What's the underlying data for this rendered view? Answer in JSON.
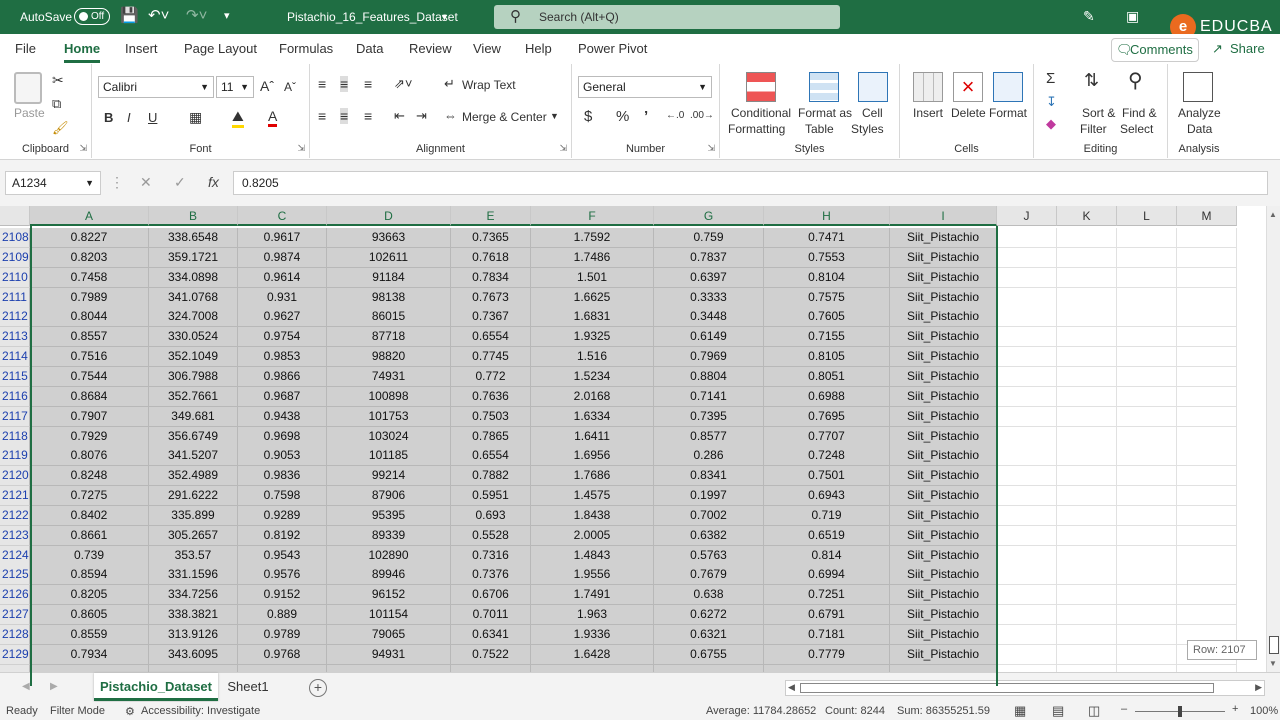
{
  "titlebar": {
    "autosave_label": "AutoSave",
    "autosave_state": "Off",
    "filename": "Pistachio_16_Features_Dataset",
    "search_placeholder": "Search (Alt+Q)",
    "logo_text": "EDUCBA"
  },
  "tabs": [
    "File",
    "Home",
    "Insert",
    "Page Layout",
    "Formulas",
    "Data",
    "Review",
    "View",
    "Help",
    "Power Pivot"
  ],
  "active_tab": "Home",
  "comments_label": "Comments",
  "share_label": "Share",
  "ribbon": {
    "clipboard": {
      "label": "Clipboard",
      "paste": "Paste"
    },
    "font": {
      "label": "Font",
      "name": "Calibri",
      "size": "11"
    },
    "alignment": {
      "label": "Alignment",
      "wrap": "Wrap Text",
      "merge": "Merge & Center"
    },
    "number": {
      "label": "Number",
      "format": "General"
    },
    "styles": {
      "label": "Styles",
      "cond1": "Conditional",
      "cond2": "Formatting",
      "fmt1": "Format as",
      "fmt2": "Table",
      "cell1": "Cell",
      "cell2": "Styles"
    },
    "cells": {
      "label": "Cells",
      "insert": "Insert",
      "delete": "Delete",
      "format": "Format"
    },
    "editing": {
      "label": "Editing",
      "sort1": "Sort &",
      "sort2": "Filter",
      "find1": "Find &",
      "find2": "Select"
    },
    "analysis": {
      "label": "Analysis",
      "analyze1": "Analyze",
      "analyze2": "Data"
    }
  },
  "namebox": "A1234",
  "formula_value": "0.8205",
  "columns": [
    "A",
    "B",
    "C",
    "D",
    "E",
    "F",
    "G",
    "H",
    "I",
    "J",
    "K",
    "L",
    "M"
  ],
  "rows": [
    {
      "n": "2108",
      "v": [
        "0.8227",
        "338.6548",
        "0.9617",
        "93663",
        "0.7365",
        "1.7592",
        "0.759",
        "0.7471",
        "Siit_Pistachio"
      ]
    },
    {
      "n": "2109",
      "v": [
        "0.8203",
        "359.1721",
        "0.9874",
        "102611",
        "0.7618",
        "1.7486",
        "0.7837",
        "0.7553",
        "Siit_Pistachio"
      ]
    },
    {
      "n": "2110",
      "v": [
        "0.7458",
        "334.0898",
        "0.9614",
        "91184",
        "0.7834",
        "1.501",
        "0.6397",
        "0.8104",
        "Siit_Pistachio"
      ]
    },
    {
      "n": "2111",
      "v": [
        "0.7989",
        "341.0768",
        "0.931",
        "98138",
        "0.7673",
        "1.6625",
        "0.3333",
        "0.7575",
        "Siit_Pistachio"
      ]
    },
    {
      "n": "2112",
      "v": [
        "0.8044",
        "324.7008",
        "0.9627",
        "86015",
        "0.7367",
        "1.6831",
        "0.3448",
        "0.7605",
        "Siit_Pistachio"
      ]
    },
    {
      "n": "2113",
      "v": [
        "0.8557",
        "330.0524",
        "0.9754",
        "87718",
        "0.6554",
        "1.9325",
        "0.6149",
        "0.7155",
        "Siit_Pistachio"
      ]
    },
    {
      "n": "2114",
      "v": [
        "0.7516",
        "352.1049",
        "0.9853",
        "98820",
        "0.7745",
        "1.516",
        "0.7969",
        "0.8105",
        "Siit_Pistachio"
      ]
    },
    {
      "n": "2115",
      "v": [
        "0.7544",
        "306.7988",
        "0.9866",
        "74931",
        "0.772",
        "1.5234",
        "0.8804",
        "0.8051",
        "Siit_Pistachio"
      ]
    },
    {
      "n": "2116",
      "v": [
        "0.8684",
        "352.7661",
        "0.9687",
        "100898",
        "0.7636",
        "2.0168",
        "0.7141",
        "0.6988",
        "Siit_Pistachio"
      ]
    },
    {
      "n": "2117",
      "v": [
        "0.7907",
        "349.681",
        "0.9438",
        "101753",
        "0.7503",
        "1.6334",
        "0.7395",
        "0.7695",
        "Siit_Pistachio"
      ]
    },
    {
      "n": "2118",
      "v": [
        "0.7929",
        "356.6749",
        "0.9698",
        "103024",
        "0.7865",
        "1.6411",
        "0.8577",
        "0.7707",
        "Siit_Pistachio"
      ]
    },
    {
      "n": "2119",
      "v": [
        "0.8076",
        "341.5207",
        "0.9053",
        "101185",
        "0.6554",
        "1.6956",
        "0.286",
        "0.7248",
        "Siit_Pistachio"
      ]
    },
    {
      "n": "2120",
      "v": [
        "0.8248",
        "352.4989",
        "0.9836",
        "99214",
        "0.7882",
        "1.7686",
        "0.8341",
        "0.7501",
        "Siit_Pistachio"
      ]
    },
    {
      "n": "2121",
      "v": [
        "0.7275",
        "291.6222",
        "0.7598",
        "87906",
        "0.5951",
        "1.4575",
        "0.1997",
        "0.6943",
        "Siit_Pistachio"
      ]
    },
    {
      "n": "2122",
      "v": [
        "0.8402",
        "335.899",
        "0.9289",
        "95395",
        "0.693",
        "1.8438",
        "0.7002",
        "0.719",
        "Siit_Pistachio"
      ]
    },
    {
      "n": "2123",
      "v": [
        "0.8661",
        "305.2657",
        "0.8192",
        "89339",
        "0.5528",
        "2.0005",
        "0.6382",
        "0.6519",
        "Siit_Pistachio"
      ]
    },
    {
      "n": "2124",
      "v": [
        "0.739",
        "353.57",
        "0.9543",
        "102890",
        "0.7316",
        "1.4843",
        "0.5763",
        "0.814",
        "Siit_Pistachio"
      ]
    },
    {
      "n": "2125",
      "v": [
        "0.8594",
        "331.1596",
        "0.9576",
        "89946",
        "0.7376",
        "1.9556",
        "0.7679",
        "0.6994",
        "Siit_Pistachio"
      ]
    },
    {
      "n": "2126",
      "v": [
        "0.8205",
        "334.7256",
        "0.9152",
        "96152",
        "0.6706",
        "1.7491",
        "0.638",
        "0.7251",
        "Siit_Pistachio"
      ]
    },
    {
      "n": "2127",
      "v": [
        "0.8605",
        "338.3821",
        "0.889",
        "101154",
        "0.7011",
        "1.963",
        "0.6272",
        "0.6791",
        "Siit_Pistachio"
      ]
    },
    {
      "n": "2128",
      "v": [
        "0.8559",
        "313.9126",
        "0.9789",
        "79065",
        "0.6341",
        "1.9336",
        "0.6321",
        "0.7181",
        "Siit_Pistachio"
      ]
    },
    {
      "n": "2129",
      "v": [
        "0.7934",
        "343.6095",
        "0.9768",
        "94931",
        "0.7522",
        "1.6428",
        "0.6755",
        "0.7779",
        "Siit_Pistachio"
      ]
    }
  ],
  "row_tooltip": "Row: 2107",
  "sheets": [
    "Pistachio_Dataset",
    "Sheet1"
  ],
  "active_sheet": "Pistachio_Dataset",
  "status": {
    "ready": "Ready",
    "filter_mode": "Filter Mode",
    "accessibility": "Accessibility: Investigate",
    "average": "Average: 11784.28652",
    "count": "Count: 8244",
    "sum": "Sum: 86355251.59",
    "zoom": "100%"
  },
  "colors": {
    "accent": "#1f6e43",
    "selection": "#d0d0d0",
    "brand": "#ea6a1f"
  }
}
